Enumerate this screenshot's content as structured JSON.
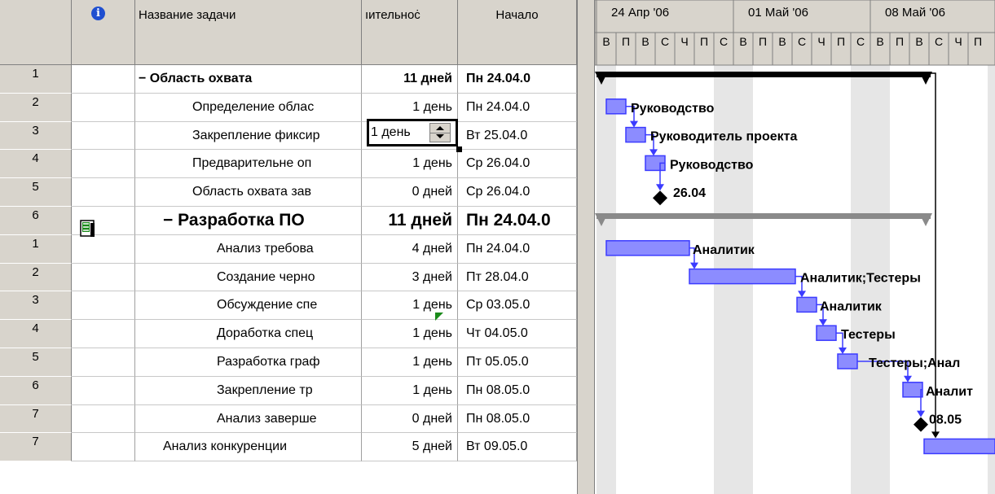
{
  "table": {
    "columns": {
      "id": "",
      "info_icon": "i",
      "name": "Название задачи",
      "duration": "ıительноċ",
      "start": "Начало"
    },
    "rows": [
      {
        "id": "1",
        "name": "− Область охвата",
        "indent": 0,
        "summary": true,
        "big": false,
        "duration": "11 дней",
        "start": "Пн 24.04.0"
      },
      {
        "id": "2",
        "name": "Определение облас",
        "indent": 2,
        "summary": false,
        "big": false,
        "duration": "1 день",
        "start": "Пн 24.04.0"
      },
      {
        "id": "3",
        "name": "Закрепление фиксир",
        "indent": 2,
        "summary": false,
        "big": false,
        "duration": "1 день",
        "start": "Вт 25.04.0",
        "editing": true
      },
      {
        "id": "4",
        "name": "Предварительне оп",
        "indent": 2,
        "summary": false,
        "big": false,
        "duration": "1 день",
        "start": "Ср 26.04.0"
      },
      {
        "id": "5",
        "name": "Область охвата зав",
        "indent": 2,
        "summary": false,
        "big": false,
        "duration": "0 дней",
        "start": "Ср 26.04.0"
      },
      {
        "id": "6",
        "name": "− Разработка ПО",
        "indent": 1,
        "summary": true,
        "big": true,
        "duration": "11 дней",
        "start": "Пн 24.04.0"
      },
      {
        "id": "1",
        "name": "Анализ требова",
        "indent": 3,
        "summary": false,
        "big": false,
        "duration": "4 дней",
        "start": "Пн 24.04.0"
      },
      {
        "id": "2",
        "name": "Создание черно",
        "indent": 3,
        "summary": false,
        "big": false,
        "duration": "3 дней",
        "start": "Пт 28.04.0"
      },
      {
        "id": "3",
        "name": "Обсуждение спе",
        "indent": 3,
        "summary": false,
        "big": false,
        "duration": "1 день",
        "start": "Ср 03.05.0"
      },
      {
        "id": "4",
        "name": "Доработка спец",
        "indent": 3,
        "summary": false,
        "big": false,
        "duration": "1 день",
        "start": "Чт 04.05.0"
      },
      {
        "id": "5",
        "name": "Разработка граф",
        "indent": 3,
        "summary": false,
        "big": false,
        "duration": "1 день",
        "start": "Пт 05.05.0"
      },
      {
        "id": "6",
        "name": "Закрепление тр",
        "indent": 3,
        "summary": false,
        "big": false,
        "duration": "1 день",
        "start": "Пн 08.05.0"
      },
      {
        "id": "7",
        "name": "Анализ заверше",
        "indent": 3,
        "summary": false,
        "big": false,
        "duration": "0 дней",
        "start": "Пн 08.05.0"
      },
      {
        "id": "7",
        "name": "Анализ конкуренции",
        "indent": 1,
        "summary": false,
        "big": false,
        "duration": "5 дней",
        "start": "Вт 09.05.0"
      }
    ],
    "editor_value": "1 день"
  },
  "gantt": {
    "weeks": [
      "24 Апр '06",
      "01 Май '06",
      "08 Май '06"
    ],
    "days": [
      "В",
      "П",
      "В",
      "С",
      "Ч",
      "П",
      "С",
      "В",
      "П",
      "В",
      "С",
      "Ч",
      "П",
      "С",
      "В",
      "П",
      "В",
      "С",
      "Ч",
      "П"
    ],
    "bar_labels": [
      {
        "row": 1,
        "text": "Руководство"
      },
      {
        "row": 2,
        "text": "Руководитель проекта"
      },
      {
        "row": 3,
        "text": "Руководство"
      },
      {
        "row": 4,
        "text": "26.04"
      },
      {
        "row": 6,
        "text": "Аналитик"
      },
      {
        "row": 7,
        "text": "Аналитик;Тестеры"
      },
      {
        "row": 8,
        "text": "Аналитик"
      },
      {
        "row": 9,
        "text": "Тестеры"
      },
      {
        "row": 10,
        "text": "Тестеры;Анал"
      },
      {
        "row": 11,
        "text": "Аналит"
      },
      {
        "row": 12,
        "text": "08.05"
      }
    ],
    "colors": {
      "bar": "#3b3bff",
      "bar_fill": "#8c8cff",
      "summary": "#000000",
      "summary_gray": "#8a8a8a",
      "nonwork": "#e6e6e6"
    }
  }
}
